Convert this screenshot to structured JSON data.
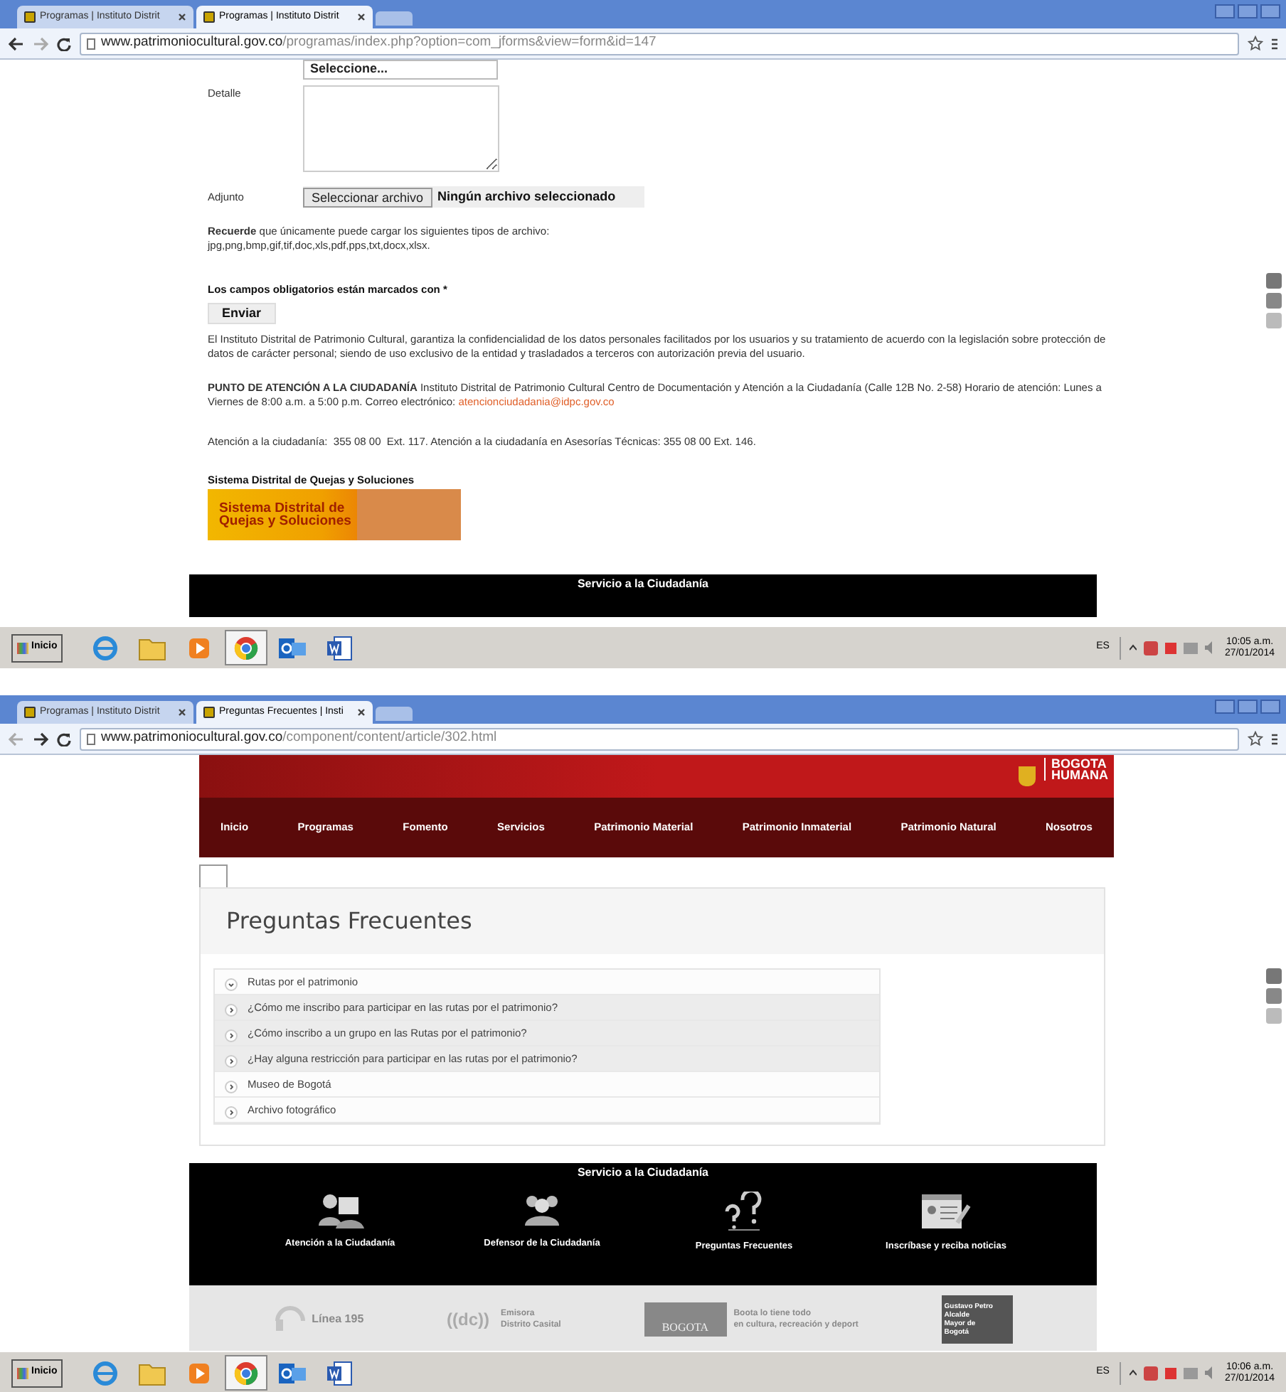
{
  "screens": [
    {
      "browser": {
        "tabs": [
          {
            "title": "Programas | Instituto Distrit",
            "selected": false
          },
          {
            "title": "Programas | Instituto Distrit",
            "selected": true
          }
        ],
        "url_host": "www.patrimoniocultural.gov.co",
        "url_path": "/programas/index.php?option=com_jforms&view=form&id=147",
        "back_enabled": true
      },
      "page": {
        "kind": "form",
        "select_value": "Seleccione...",
        "detail_label": "Detalle",
        "attachment_label": "Adjunto",
        "file_button": "Seleccionar archivo",
        "file_status": "Ningún archivo seleccionado",
        "reminder_lines": [
          "**Recuerde** que únicamente puede cargar los siguientes tipos de archivo:",
          "jpg,png,bmp,gif,tif,doc,xls,pdf,pps,txt,docx,xlsx."
        ],
        "required_note": "Los campos obligatorios están marcados con *",
        "submit": "Enviar",
        "privacy": "El Instituto Distrital de Patrimonio Cultural, garantiza la confidencialidad de los datos personales facilitados por los usuarios y su tratamiento de acuerdo con la legislación sobre protección de datos de carácter personal; siendo de uso exclusivo de la entidad y trasladados a terceros con autorización previa del usuario.",
        "attention": "**PUNTO DE ATENCIÓN A LA CIUDADANÍA** Instituto Distrital de Patrimonio Cultural Centro de Documentación y Atención a la Ciudadanía (Calle 12B No. 2-58) Horario de atención: Lunes a Viernes de 8:00 a.m. a 5:00 p.m. Correo electrónico:",
        "email": "atencionciudadania@idpc.gov.co",
        "phones": "Atención a la ciudadanía:  355 08 00  Ext. 117. Atención a la ciudadanía en Asesorías Técnicas: 355 08 00 Ext. 146.",
        "complaints_title": "Sistema Distrital de Quejas y Soluciones",
        "banner_lines": [
          "Sistema Distrital de",
          "Quejas y Soluciones"
        ],
        "footer_title": "Servicio a la Ciudadanía"
      },
      "taskbar": {
        "start": "Inicio",
        "apps": [
          {
            "selected": false
          },
          {
            "selected": false
          },
          {
            "selected": false
          },
          {
            "selected": true
          },
          {
            "selected": false
          },
          {
            "selected": false
          }
        ],
        "lang": "ES",
        "time": "10:05 a.m.",
        "date": "27/01/2014"
      }
    },
    {
      "browser": {
        "tabs": [
          {
            "title": "Programas | Instituto Distrit",
            "selected": false
          },
          {
            "title": "Preguntas Frecuentes | Insti",
            "selected": true
          }
        ],
        "url_host": "www.patrimoniocultural.gov.co",
        "url_path": "/component/content/article/302.html",
        "back_enabled": false
      },
      "page": {
        "kind": "faq",
        "logo_lines": [
          "BOGOTA",
          "HUMANA"
        ],
        "nav": [
          "Inicio",
          "Programas",
          "Fomento",
          "Servicios",
          "Patrimonio Material",
          "Patrimonio Inmaterial",
          "Patrimonio Natural",
          "Nosotros"
        ],
        "title": "Preguntas Frecuentes",
        "items": [
          {
            "label": "Rutas por el patrimonio",
            "expanded": true,
            "children": [
              {
                "label": "¿Cómo me inscribo para participar en las rutas por el patrimonio?",
                "expanded": false
              },
              {
                "label": "¿Cómo inscribo a un grupo en las Rutas por el patrimonio?",
                "expanded": false
              },
              {
                "label": "¿Hay alguna restricción para participar en las rutas por el patrimonio?",
                "expanded": false
              }
            ]
          },
          {
            "label": "Museo de Bogotá",
            "expanded": false
          },
          {
            "label": "Archivo fotográfico",
            "expanded": false
          }
        ],
        "footer_title": "Servicio a la Ciudadanía",
        "services": [
          {
            "kind": "agent",
            "label": "Atención a la Ciudadanía"
          },
          {
            "kind": "people",
            "label": "Defensor de la Ciudadanía"
          },
          {
            "kind": "questions",
            "label": "Preguntas Frecuentes"
          },
          {
            "kind": "card",
            "label": "Inscríbase y reciba noticias"
          }
        ],
        "partners": {
          "line": "Línea 195",
          "radio_logo": "((dc))",
          "radio_lines": [
            "Emisora",
            "Distrito Casital"
          ],
          "city_logo": "BOGOTA",
          "city_lines": [
            "Boota lo tiene todo",
            "en cultura, recreación y deport"
          ],
          "mayor_lines": [
            "Gustavo Petro",
            "Alcalde",
            "Mayor de",
            "Bogotá"
          ]
        }
      },
      "taskbar": {
        "start": "Inicio",
        "apps": [
          {
            "selected": false
          },
          {
            "selected": false
          },
          {
            "selected": false
          },
          {
            "selected": true
          },
          {
            "selected": false
          },
          {
            "selected": false
          }
        ],
        "lang": "ES",
        "time": "10:06 a.m.",
        "date": "27/01/2014"
      }
    }
  ]
}
